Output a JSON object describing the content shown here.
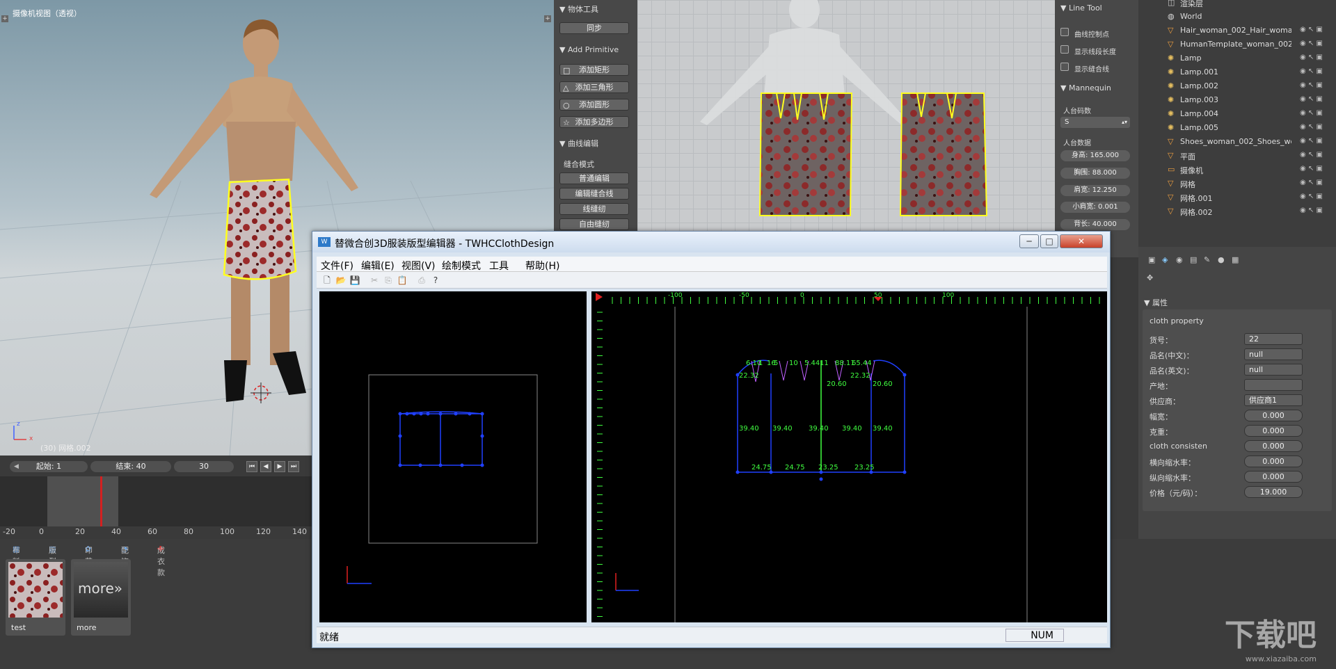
{
  "viewport3d": {
    "title": "摄像机视图（透视）",
    "status": "(30) 网格.002",
    "axis_z": "z",
    "axis_x": "x"
  },
  "timeline": {
    "start_label": "起始: 1",
    "end_label": "结束: 40",
    "frame": "30",
    "ticks": [
      "-20",
      "0",
      "20",
      "40",
      "60",
      "80",
      "100",
      "120",
      "140"
    ]
  },
  "assets": {
    "tabs": [
      "布料",
      "版型",
      "印花",
      "配饰",
      "成衣款"
    ],
    "items": [
      {
        "label": "test"
      },
      {
        "label": "more",
        "overlay": "more»"
      }
    ]
  },
  "toolpanel": {
    "section1": "▼ 物体工具",
    "sync": "同步",
    "section2": "▼ Add Primitive",
    "add_rect": "添加矩形",
    "add_tri": "添加三角形",
    "add_circle": "添加圆形",
    "add_poly": "添加多边形",
    "section3": "▼ 曲线编辑",
    "sew_mode": "缝合模式",
    "normal_edit": "普通编辑",
    "edit_seam": "编辑缝合线",
    "line_sew": "线缝纫",
    "free_sew": "自由缝纫"
  },
  "linetool": {
    "header": "▼ Line Tool",
    "cb1": "曲线控制点",
    "cb2": "显示线段长度",
    "cb3": "显示缝合线",
    "mannequin_header": "▼ Mannequin",
    "size_label": "人台码数",
    "size_value": "S",
    "data_label": "人台数据",
    "height": "身高: 165.000",
    "bust": "胸围: 88.000",
    "shoulder": "肩宽: 12.250",
    "small_shoulder": "小肩宽: 0.001",
    "back_length": "背长: 40.000"
  },
  "outliner": {
    "rows": [
      {
        "name": "渲染层",
        "icon": "render-layer-icon"
      },
      {
        "name": "World",
        "icon": "world-icon"
      },
      {
        "name": "Hair_woman_002_Hair_woman_0",
        "icon": "mesh-icon"
      },
      {
        "name": "HumanTemplate_woman_002_H",
        "icon": "mesh-icon"
      },
      {
        "name": "Lamp",
        "icon": "lamp-icon"
      },
      {
        "name": "Lamp.001",
        "icon": "lamp-icon"
      },
      {
        "name": "Lamp.002",
        "icon": "lamp-icon"
      },
      {
        "name": "Lamp.003",
        "icon": "lamp-icon"
      },
      {
        "name": "Lamp.004",
        "icon": "lamp-icon"
      },
      {
        "name": "Lamp.005",
        "icon": "lamp-icon"
      },
      {
        "name": "Shoes_woman_002_Shoes_woma",
        "icon": "mesh-icon"
      },
      {
        "name": "平面",
        "icon": "mesh-icon"
      },
      {
        "name": "摄像机",
        "icon": "camera-icon"
      },
      {
        "name": "网格",
        "icon": "mesh-icon"
      },
      {
        "name": "网格.001",
        "icon": "mesh-icon"
      },
      {
        "name": "网格.002",
        "icon": "mesh-icon"
      }
    ]
  },
  "props": {
    "header": "▼ 属性",
    "section": "cloth property",
    "rows": [
      {
        "label": "货号：",
        "value": "22"
      },
      {
        "label": "品名(中文)：",
        "value": "null"
      },
      {
        "label": "品名(英文)：",
        "value": "null"
      },
      {
        "label": "产地：",
        "value": ""
      },
      {
        "label": "供应商：",
        "value": "供应商1"
      },
      {
        "label": "幅宽：",
        "value": "0.000"
      },
      {
        "label": "克重：",
        "value": "0.000"
      },
      {
        "label": "cloth consisten",
        "value": "0.000"
      },
      {
        "label": "横向缩水率：",
        "value": "0.000"
      },
      {
        "label": "纵向缩水率：",
        "value": "0.000"
      },
      {
        "label": "价格（元/码）：",
        "value": "19.000"
      }
    ]
  },
  "editor": {
    "title": "替微合创3D服装版型编辑器 - TWHCClothDesign",
    "app_icon": "W",
    "menu": [
      "文件(F)",
      "编辑(E)",
      "视图(V)",
      "绘制模式",
      "工具",
      "帮助(H)"
    ],
    "status": "就绪",
    "num": "NUM",
    "ruler_labels": [
      "-100",
      "-50",
      "0",
      "50",
      "100"
    ],
    "dims": {
      "top": [
        "6.10",
        "1",
        "16",
        "5",
        "10",
        "5.44",
        "11",
        "88.11",
        "65.44"
      ],
      "side": [
        "22.32",
        "22.32",
        "20.60",
        "20.60"
      ],
      "height": [
        "39.40",
        "39.40",
        "39.40",
        "39.40",
        "39.40"
      ],
      "bottom": [
        "24.75",
        "24.75",
        "23.25",
        "23.25"
      ]
    }
  },
  "colors": {
    "accent_yellow": "#ffff20",
    "pattern_blue": "#2040ff",
    "dim_green": "#40ff40",
    "timeline_cursor": "#d42020"
  },
  "watermark": {
    "main": "下载吧",
    "sub": "www.xiazaiba.com"
  }
}
